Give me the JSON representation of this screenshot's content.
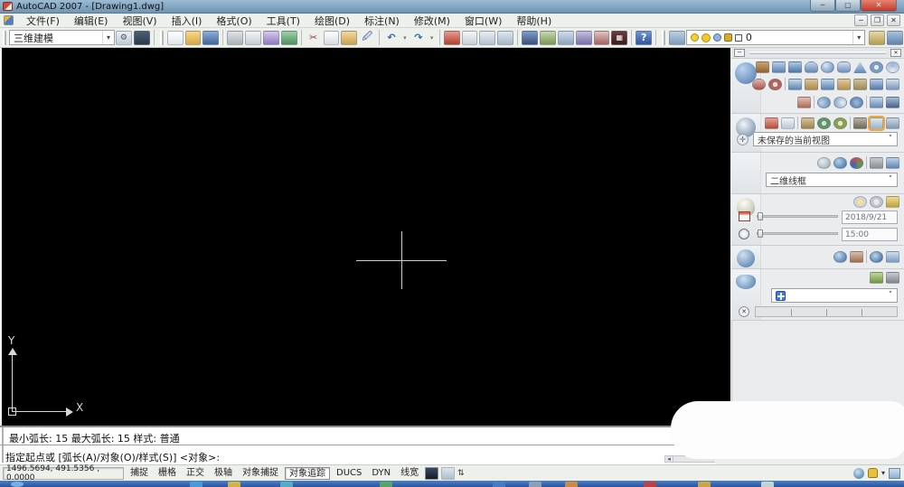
{
  "window": {
    "title": "AutoCAD 2007 - [Drawing1.dwg]"
  },
  "menu": {
    "items": [
      "文件(F)",
      "编辑(E)",
      "视图(V)",
      "插入(I)",
      "格式(O)",
      "工具(T)",
      "绘图(D)",
      "标注(N)",
      "修改(M)",
      "窗口(W)",
      "帮助(H)"
    ]
  },
  "toolbar": {
    "workspace_value": "三维建模",
    "layer_current": "0"
  },
  "dashboard": {
    "view_combo_value": "未保存的当前视图",
    "visual_style_value": "二维线框",
    "sun_date_value": "2018/9/21",
    "sun_time_value": "15:00"
  },
  "canvas": {
    "ucs_x_label": "X",
    "ucs_y_label": "Y"
  },
  "command": {
    "history_line": "最小弧长: 15    最大弧长: 15    样式: 普通",
    "prompt_line": "指定起点或  [弧长(A)/对象(O)/样式(S)] <对象>:"
  },
  "statusbar": {
    "coordinates": "1496.5694, 491.5356 , 0.0000",
    "toggles": [
      "捕捉",
      "栅格",
      "正交",
      "极轴",
      "对象捕捉",
      "对象追踪",
      "DUCS",
      "DYN",
      "线宽"
    ]
  },
  "glyphs": {
    "minimize": "─",
    "maximize": "▢",
    "close": "✕",
    "restore": "❐",
    "combo_arrow": "▾",
    "chevron_down": "˅",
    "cut": "✂",
    "undo": "↶",
    "redo": "↷",
    "tiny_arrow": "▾",
    "help": "?",
    "calc_dots": "▦",
    "view_controls": "✛",
    "render_cross": "✕",
    "scroll_left": "◂",
    "panel_minimize": "−",
    "panel_close": "✕",
    "updown": "⇅"
  },
  "colors": {
    "canvas": "#000000",
    "titlebar": "#7ba0bf",
    "highlight_orange": "#f0a830",
    "taskbar_blue": "#2f5fae",
    "layer_bulb_yellow": "#f2d12e",
    "lock_gold": "#d8a92c"
  }
}
